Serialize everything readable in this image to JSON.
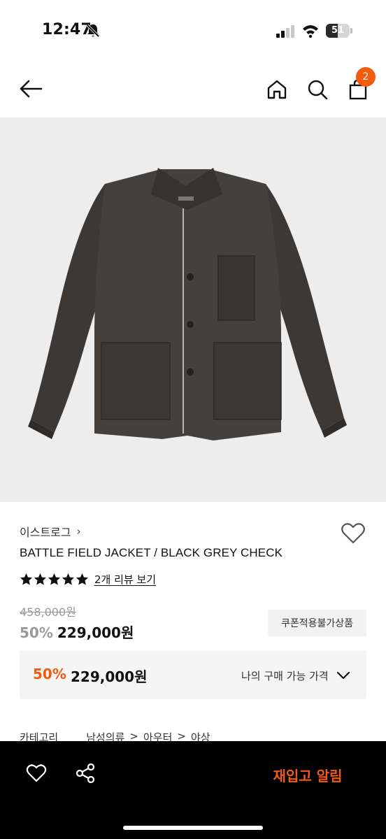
{
  "status_bar": {
    "time": "12:47",
    "battery_level": "51",
    "battery_fraction": 0.51
  },
  "header": {
    "cart_count": "2",
    "accent_color": "#f25a0e"
  },
  "product": {
    "brand": "이스트로그",
    "brand_chevron": "›",
    "title": "BATTLE FIELD JACKET / BLACK GREY CHECK",
    "rating_stars": 5,
    "review_link": "2개 리뷰 보기",
    "original_price": "458,000원",
    "discount_rate": "50%",
    "sale_price": "229,000원",
    "coupon_badge": "쿠폰적용불가상품"
  },
  "my_price": {
    "discount_rate": "50%",
    "price": "229,000원",
    "label": "나의 구매 가능 가격"
  },
  "category": {
    "label": "카테고리",
    "path": [
      "남성의류",
      ">",
      "아우터",
      ">",
      "야상"
    ]
  },
  "bottom_bar": {
    "restock_label": "재입고 알림"
  },
  "icons": {
    "back": "arrow-left-icon",
    "home": "home-icon",
    "search": "search-icon",
    "cart": "shopping-bag-icon",
    "wishlist": "heart-icon",
    "share": "share-icon"
  }
}
